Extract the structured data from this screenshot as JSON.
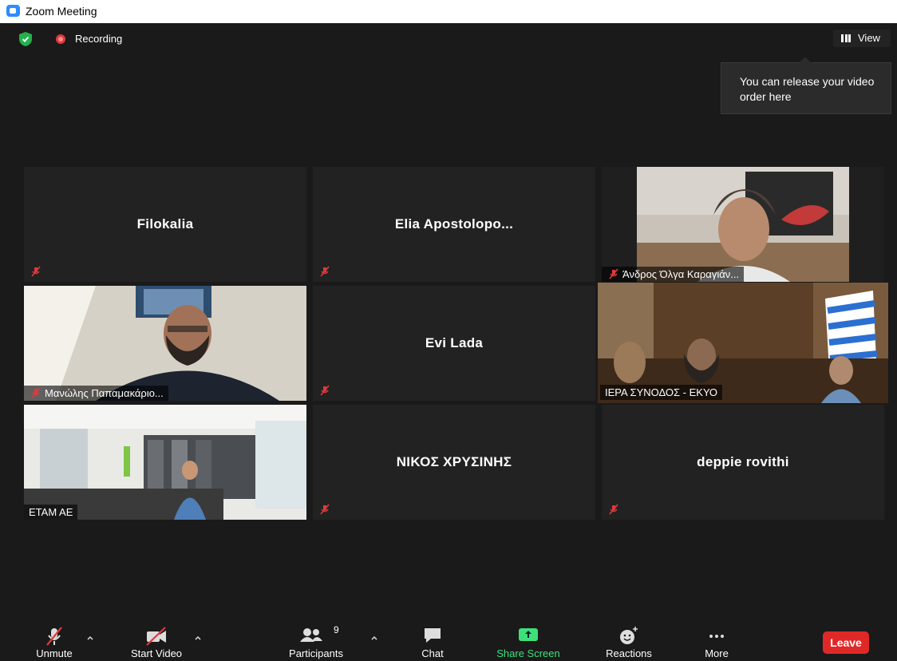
{
  "window": {
    "title": "Zoom Meeting"
  },
  "top_bar": {
    "recording_label": "Recording",
    "view_label": "View"
  },
  "tooltip": {
    "text": "You can release your video order here"
  },
  "tiles": [
    {
      "name": "Filokalia",
      "muted": true,
      "video": false
    },
    {
      "name": "Elia  Apostolopo...",
      "muted": true,
      "video": false
    },
    {
      "name": "Άνδρος Όλγα Καραγιάν...",
      "muted": true,
      "video": true
    },
    {
      "name": "Μανώλης Παπαμακάριο...",
      "muted": true,
      "video": true
    },
    {
      "name": "Evi Lada",
      "muted": true,
      "video": false
    },
    {
      "name": "ΙΕΡΑ ΣΥΝΟΔΟΣ - ΕΚΥΟ",
      "muted": false,
      "video": true,
      "active_speaker": true
    },
    {
      "name": "ΕΤΑΜ ΑΕ",
      "muted": false,
      "video": true
    },
    {
      "name": "ΝΙΚΟΣ ΧΡΥΣΙΝΗΣ",
      "muted": true,
      "video": false
    },
    {
      "name": "deppie rovithi",
      "muted": true,
      "video": false
    }
  ],
  "toolbar": {
    "unmute": "Unmute",
    "start_video": "Start Video",
    "participants": "Participants",
    "participants_count": "9",
    "chat": "Chat",
    "share_screen": "Share Screen",
    "reactions": "Reactions",
    "more": "More",
    "leave": "Leave"
  },
  "colors": {
    "background": "#1a1a1a",
    "tile": "#222222",
    "active_speaker_border": "#cbe85a",
    "leave": "#e02828",
    "share_screen": "#3ee07a",
    "muted_red": "#e0383e"
  }
}
